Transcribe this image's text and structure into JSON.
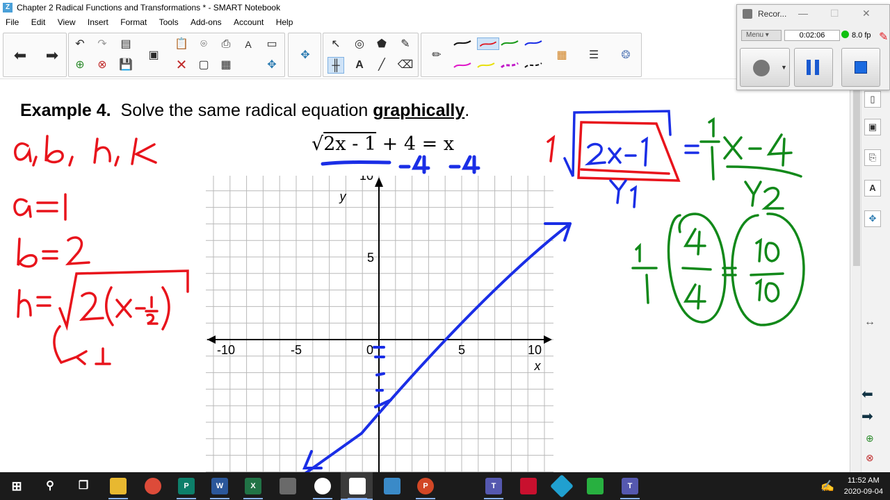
{
  "window": {
    "title": "Chapter 2 Radical Functions and Transformations * - SMART Notebook",
    "app_icon": "Z"
  },
  "menu": [
    "File",
    "Edit",
    "View",
    "Insert",
    "Format",
    "Tools",
    "Add-ons",
    "Account",
    "Help"
  ],
  "page": {
    "heading_prefix": "Example 4.",
    "heading_text": "Solve the same radical equation",
    "heading_emph": "graphically",
    "heading_end": ".",
    "equation": {
      "root_symbol": "√",
      "radicand": "2x - 1",
      "rest": " + 4 = x"
    }
  },
  "graph": {
    "x_axis_label": "x",
    "y_axis_label": "y",
    "tick_labels": {
      "x_neg10": "-10",
      "x_neg5": "-5",
      "x_0": "0",
      "x_5": "5",
      "x_10": "10",
      "y_10": "10",
      "y_5": "5"
    }
  },
  "recorder": {
    "title": "Recor...",
    "menu_label": "Menu",
    "elapsed": "0:02:06",
    "fps": "8.0 fp"
  },
  "taskbar": {
    "time": "11:52 AM",
    "date": "2020-09-04"
  },
  "colors": {
    "ink_red": "#e8141c",
    "ink_blue": "#1a2ee6",
    "ink_green": "#12891a",
    "grid": "#b9b9b9"
  },
  "icons": {
    "back": "arrow-left-icon",
    "forward": "arrow-right-icon",
    "undo": "undo-icon",
    "redo": "redo-icon",
    "pen": "pen-icon",
    "eraser": "eraser-icon"
  }
}
